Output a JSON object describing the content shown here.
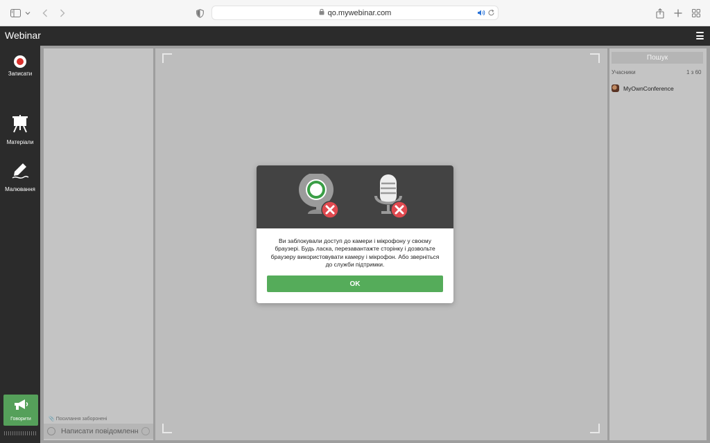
{
  "browser": {
    "url": "qo.mywebinar.com",
    "icons": [
      "sidebar-icon",
      "chevron-down-icon",
      "back-icon",
      "forward-icon",
      "shield-icon",
      "lock-icon",
      "speaker-icon",
      "reload-icon",
      "share-icon",
      "plus-icon",
      "tabs-grid-icon"
    ]
  },
  "app": {
    "title": "Webinar"
  },
  "sidebar": {
    "items": [
      {
        "label": "Записати",
        "icon": "record-icon"
      },
      {
        "label": "Матеріали",
        "icon": "presentation-easel-icon"
      },
      {
        "label": "Малювання",
        "icon": "pen-drawing-icon"
      }
    ],
    "speak": {
      "label": "Говорити",
      "icon": "megaphone-icon"
    }
  },
  "chat": {
    "links_note": "Посилання заборонені",
    "input_placeholder": "Написати повідомлення"
  },
  "participants": {
    "search_label": "Пошук",
    "header": "Учасники",
    "count": "1 з 60",
    "list": [
      {
        "name": "MyOwnConference"
      }
    ]
  },
  "modal": {
    "icons": [
      "webcam-blocked-icon",
      "microphone-blocked-icon"
    ],
    "message": "Ви заблокували доступ до камери і мікрофону у своєму браузері. Будь ласка, перезавантажте сторінку і дозвольте браузеру використовувати камеру і мікрофон. Або зверніться до служби підтримки.",
    "ok_label": "OK"
  },
  "colors": {
    "dark": "#2b2b2b",
    "accent_green": "#55ac5a",
    "record_red": "#d9312d",
    "blocked_red": "#e0494f"
  }
}
